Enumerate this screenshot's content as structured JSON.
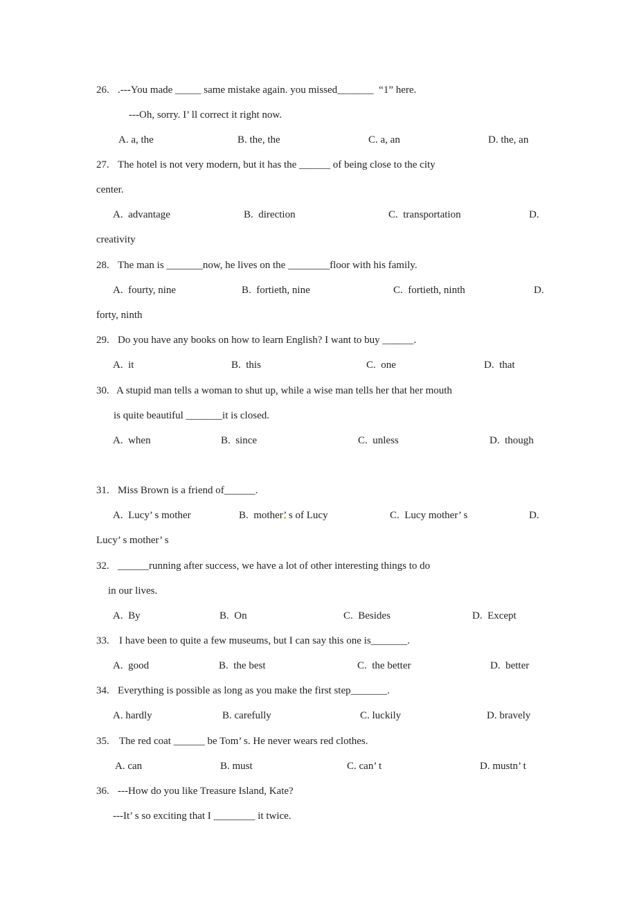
{
  "questions": [
    {
      "number": "26.",
      "lines": [
        ".---You made _____ same mistake again. you missed_______  “1” here.",
        "---Oh, sorry. I’ ll correct it right now."
      ],
      "options": [
        "A. a, the",
        "B. the, the",
        "C. a, an",
        "D. the, an"
      ]
    },
    {
      "number": "27.",
      "lines": [
        "The hotel is not very modern, but it has the ______ of being close to the city",
        "center."
      ],
      "options": [
        "A.  advantage",
        "B.  direction",
        "C.  transportation",
        "D.",
        "creativity"
      ]
    },
    {
      "number": "28.",
      "lines": [
        "The man is _______now, he lives on the ________floor with his family."
      ],
      "options": [
        "A.  fourty, nine",
        "B.  fortieth, nine",
        "C.  fortieth, ninth",
        "D.",
        "forty, ninth"
      ]
    },
    {
      "number": "29.",
      "lines": [
        "Do you have any books on how to learn English? I want to buy ______."
      ],
      "options": [
        "A.  it",
        "B.  this",
        "C.  one",
        "D.  that"
      ]
    },
    {
      "number": "30.",
      "lines": [
        "A stupid man tells a woman to shut up, while a wise man tells her that her mouth",
        "is quite beautiful _______it is closed."
      ],
      "options": [
        "A.  when",
        "B.  since",
        "C.  unless",
        "D.  though"
      ]
    },
    {
      "number": "31.",
      "lines": [
        "Miss Brown is a friend of______."
      ],
      "options": [
        "A.  Lucy’ s mother",
        "B.  mother’ s of Lucy",
        "C.  Lucy mother’ s",
        "D.",
        "Lucy’ s mother’ s"
      ]
    },
    {
      "number": "32.",
      "lines": [
        "______running after success, we have a lot of other interesting things to do",
        "in our lives."
      ],
      "options": [
        "A.  By",
        "B.  On",
        "C.  Besides",
        "D.  Except"
      ]
    },
    {
      "number": "33.",
      "lines": [
        "I have been to quite a few museums, but I can say this one is_______."
      ],
      "options": [
        "A.  good",
        "B.  the best",
        "C.  the better",
        "D.  better"
      ]
    },
    {
      "number": "34.",
      "lines": [
        "Everything is possible as long as you make the first step_______."
      ],
      "options": [
        "A. hardly",
        "B. carefully",
        "C. luckily",
        "D. bravely"
      ]
    },
    {
      "number": "35.",
      "lines": [
        "The red coat ______ be Tom’ s. He never wears red clothes."
      ],
      "options": [
        "A. can",
        "B. must",
        "C. can’ t",
        "D. mustn’ t"
      ]
    },
    {
      "number": "36.",
      "lines": [
        "---How do you like Treasure Island, Kate?",
        "---It’ s so exciting that I ________ it twice."
      ],
      "options": []
    }
  ]
}
